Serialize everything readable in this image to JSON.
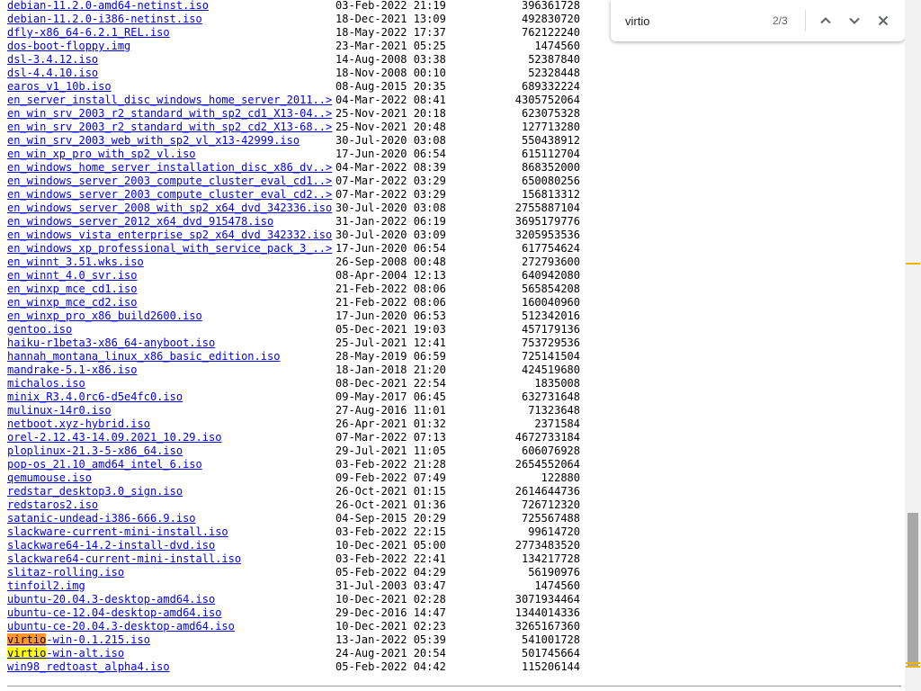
{
  "find_bar": {
    "query": "virtio",
    "match_count": "2/3",
    "highlight_active": "#ff9632",
    "highlight_other": "#ffff00"
  },
  "listing": {
    "link_color": "#0000ee",
    "rows": [
      {
        "name": "debian-11.2.0-amd64-netinst.iso",
        "date": "03-Feb-2022 21:19",
        "size": "396361728"
      },
      {
        "name": "debian-11.2.0-i386-netinst.iso",
        "date": "18-Dec-2021 13:09",
        "size": "492830720"
      },
      {
        "name": "dfly-x86_64-6.2.1_REL.iso",
        "date": "18-May-2022 17:37",
        "size": "762122240"
      },
      {
        "name": "dos-boot-floppy.img",
        "date": "23-Mar-2021 05:25",
        "size": "1474560"
      },
      {
        "name": "dsl-3.4.12.iso",
        "date": "14-Aug-2008 03:38",
        "size": "52387840"
      },
      {
        "name": "dsl-4.4.10.iso",
        "date": "18-Nov-2008 00:10",
        "size": "52328448"
      },
      {
        "name": "earos_v1_10b.iso",
        "date": "08-Aug-2015 20:35",
        "size": "689332224"
      },
      {
        "name": "en_server_install_disc_windows_home_server_2011..>",
        "date": "04-Mar-2022 08:41",
        "size": "4305752064"
      },
      {
        "name": "en_win_srv_2003_r2_standard_with_sp2_cd1_X13-04..>",
        "date": "25-Nov-2021 20:18",
        "size": "623075328"
      },
      {
        "name": "en_win_srv_2003_r2_standard_with_sp2_cd2_X13-68..>",
        "date": "25-Nov-2021 20:48",
        "size": "127713280"
      },
      {
        "name": "en_win_srv_2003_web_with_sp2_vl_x13-42999.iso",
        "date": "30-Jul-2020 03:08",
        "size": "550438912"
      },
      {
        "name": "en_win_xp_pro_with_sp2_vl.iso",
        "date": "17-Jun-2020 06:54",
        "size": "615112704"
      },
      {
        "name": "en_windows_home_server_installation_disc_x86_dv..>",
        "date": "04-Mar-2022 08:39",
        "size": "868352000"
      },
      {
        "name": "en_windows_server_2003_compute_cluster_eval_cd1..>",
        "date": "07-Mar-2022 03:29",
        "size": "650080256"
      },
      {
        "name": "en_windows_server_2003_compute_cluster_eval_cd2..>",
        "date": "07-Mar-2022 03:29",
        "size": "156813312"
      },
      {
        "name": "en_windows_server_2008_with_sp2_x64_dvd_342336.iso",
        "date": "30-Jul-2020 03:08",
        "size": "2755887104"
      },
      {
        "name": "en_windows_server_2012_x64_dvd_915478.iso",
        "date": "31-Jan-2022 06:19",
        "size": "3695179776"
      },
      {
        "name": "en_windows_vista_enterprise_sp2_x64_dvd_342332.iso",
        "date": "30-Jul-2020 03:09",
        "size": "3205953536"
      },
      {
        "name": "en_windows_xp_professional_with_service_pack_3_..>",
        "date": "17-Jun-2020 06:54",
        "size": "617754624"
      },
      {
        "name": "en_winnt_3.51.wks.iso",
        "date": "26-Sep-2008 00:48",
        "size": "272793600"
      },
      {
        "name": "en_winnt_4.0_svr.iso",
        "date": "08-Apr-2004 12:13",
        "size": "640942080"
      },
      {
        "name": "en_winxp_mce_cd1.iso",
        "date": "21-Feb-2022 08:06",
        "size": "565854208"
      },
      {
        "name": "en_winxp_mce_cd2.iso",
        "date": "21-Feb-2022 08:06",
        "size": "160040960"
      },
      {
        "name": "en_winxp_pro_x86_build2600.iso",
        "date": "17-Jun-2020 06:53",
        "size": "512342016"
      },
      {
        "name": "gentoo.iso",
        "date": "05-Dec-2021 19:03",
        "size": "457179136"
      },
      {
        "name": "haiku-r1beta3-x86_64-anyboot.iso",
        "date": "25-Jul-2021 12:41",
        "size": "753729536"
      },
      {
        "name": "hannah_montana_linux_x86_basic_edition.iso",
        "date": "28-May-2019 06:59",
        "size": "725141504"
      },
      {
        "name": "mandrake-5.1-x86.iso",
        "date": "18-Jan-2018 21:20",
        "size": "424519680"
      },
      {
        "name": "michalos.iso",
        "date": "08-Dec-2021 22:54",
        "size": "1835008"
      },
      {
        "name": "minix_R3.4.0rc6-d5e4fc0.iso",
        "date": "09-May-2017 06:45",
        "size": "632731648"
      },
      {
        "name": "mulinux-14r0.iso",
        "date": "27-Aug-2016 11:01",
        "size": "71323648"
      },
      {
        "name": "netboot.xyz-hybrid.iso",
        "date": "26-Apr-2021 01:32",
        "size": "2371584"
      },
      {
        "name": "orel-2.12.43-14.09.2021_10.29.iso",
        "date": "07-Mar-2022 07:13",
        "size": "4672733184"
      },
      {
        "name": "ploplinux-21.3-5-x86_64.iso",
        "date": "29-Jul-2021 11:05",
        "size": "606076928"
      },
      {
        "name": "pop-os_21.10_amd64_intel_6.iso",
        "date": "03-Feb-2022 21:28",
        "size": "2654552064"
      },
      {
        "name": "qemumouse.iso",
        "date": "09-Feb-2022 07:49",
        "size": "122880"
      },
      {
        "name": "redstar_desktop3.0_sign.iso",
        "date": "26-Oct-2021 01:15",
        "size": "2614644736"
      },
      {
        "name": "redstaros2.iso",
        "date": "26-Oct-2021 01:36",
        "size": "726712320"
      },
      {
        "name": "satanic-undead-i386-666.9.iso",
        "date": "04-Sep-2015 20:29",
        "size": "725567488"
      },
      {
        "name": "slackware-current-mini-install.iso",
        "date": "03-Feb-2022 22:15",
        "size": "99614720"
      },
      {
        "name": "slackware64-14.2-install-dvd.iso",
        "date": "10-Dec-2021 05:00",
        "size": "2773483520"
      },
      {
        "name": "slackware64-current-mini-install.iso",
        "date": "03-Feb-2022 22:41",
        "size": "134217728"
      },
      {
        "name": "slitaz-rolling.iso",
        "date": "05-Feb-2022 04:29",
        "size": "56190976"
      },
      {
        "name": "tinfoil2.img",
        "date": "31-Jul-2003 03:47",
        "size": "1474560"
      },
      {
        "name": "ubuntu-20.04.3-desktop-amd64.iso",
        "date": "10-Dec-2021 02:28",
        "size": "3071934464"
      },
      {
        "name": "ubuntu-ce-12.04-desktop-amd64.iso",
        "date": "29-Dec-2016 14:47",
        "size": "1344014336"
      },
      {
        "name": "ubuntu-ce-20.04.3-desktop-amd64.iso",
        "date": "10-Dec-2021 02:23",
        "size": "3265167360"
      },
      {
        "name": "virtio-win-0.1.215.iso",
        "date": "13-Jan-2022 05:39",
        "size": "541001728",
        "highlight": "active"
      },
      {
        "name": "virtio-win-alt.iso",
        "date": "24-Aug-2021 20:54",
        "size": "501745664",
        "highlight": "other"
      },
      {
        "name": "win98_redtoast_alpha4.iso",
        "date": "05-Feb-2022 04:42",
        "size": "115206144"
      }
    ]
  },
  "scrollbar": {
    "position_fraction": 0.74,
    "thumb_color": "#a8a8a8",
    "match_tick_color": "#f0b400",
    "match_ticks": 3
  },
  "icons": {
    "prev": "chevron-up-icon",
    "next": "chevron-down-icon",
    "close": "close-icon"
  }
}
